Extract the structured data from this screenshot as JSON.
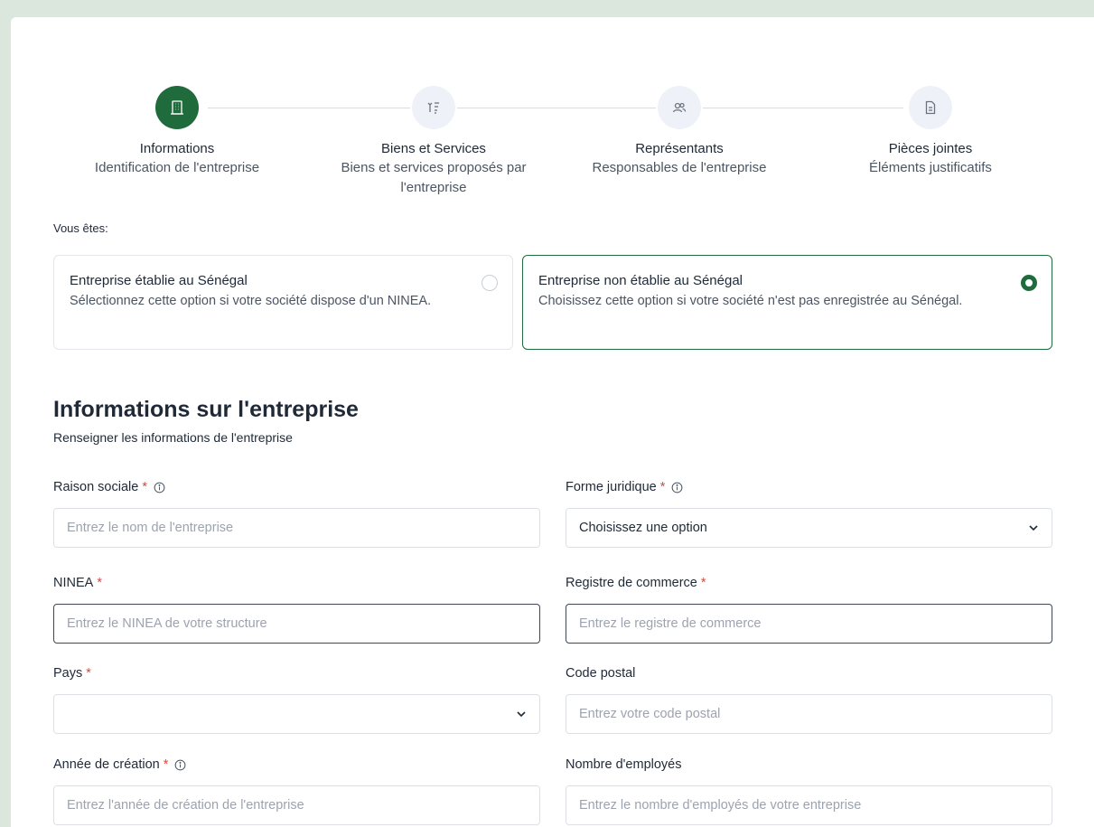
{
  "stepper": {
    "steps": [
      {
        "title": "Informations",
        "desc": "Identification de l'entreprise",
        "icon": "building-icon",
        "active": true
      },
      {
        "title": "Biens et Services",
        "desc_line1": "Biens et services proposés par",
        "desc_line2": "l'entreprise",
        "icon": "list-filter-icon",
        "active": false
      },
      {
        "title": "Représentants",
        "desc": "Responsables de l'entreprise",
        "icon": "users-icon",
        "active": false
      },
      {
        "title": "Pièces jointes",
        "desc": "Éléments justificatifs",
        "icon": "document-icon",
        "active": false
      }
    ]
  },
  "company_type": {
    "label": "Vous êtes:",
    "options": [
      {
        "title": "Entreprise établie au Sénégal",
        "desc": "Sélectionnez cette option si votre société dispose d'un NINEA.",
        "selected": false
      },
      {
        "title": "Entreprise non établie au Sénégal",
        "desc": "Choisissez cette option si votre société n'est pas enregistrée au Sénégal.",
        "selected": true
      }
    ]
  },
  "section": {
    "title": "Informations sur l'entreprise",
    "subtitle": "Renseigner les informations de l'entreprise"
  },
  "fields": {
    "raison_sociale": {
      "label": "Raison sociale",
      "required": "*",
      "placeholder": "Entrez le nom de l'entreprise"
    },
    "forme_juridique": {
      "label": "Forme juridique",
      "required": "*",
      "value": "Choisissez une option"
    },
    "ninea": {
      "label": "NINEA",
      "required": "*",
      "placeholder": "Entrez le NINEA de votre structure"
    },
    "registre": {
      "label": "Registre de commerce",
      "required": "*",
      "placeholder": "Entrez le registre de commerce"
    },
    "pays": {
      "label": "Pays",
      "required": "*",
      "value": ""
    },
    "code_postal": {
      "label": "Code postal",
      "placeholder": "Entrez votre code postal"
    },
    "annee": {
      "label": "Année de création",
      "required": "*",
      "placeholder": "Entrez l'année de création de l'entreprise"
    },
    "employes": {
      "label": "Nombre d'employés",
      "placeholder": "Entrez le nombre d'employés de votre entreprise"
    }
  },
  "colors": {
    "accent": "#1f6b3b",
    "required": "#e0463b",
    "background": "#dbe6dc"
  }
}
